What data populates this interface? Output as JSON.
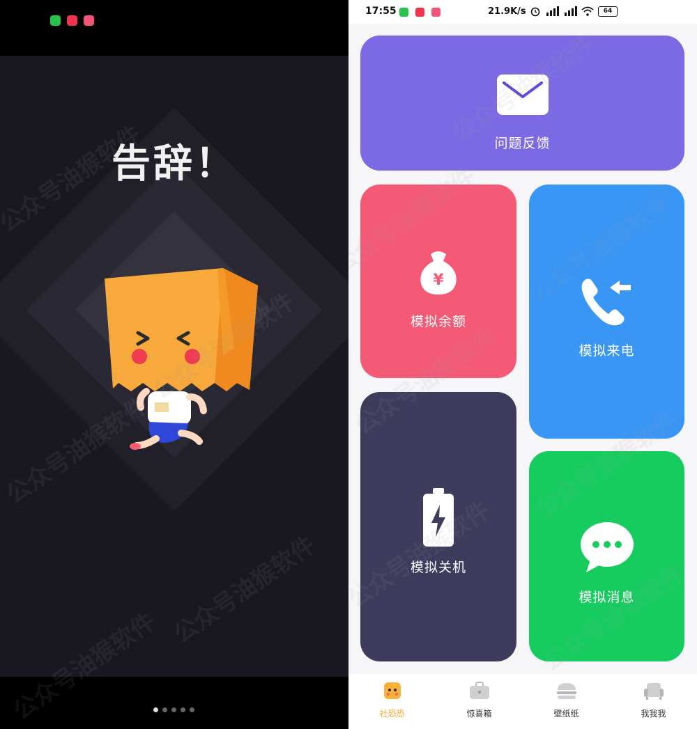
{
  "left_screen": {
    "headline": "告辞！",
    "pager": {
      "count": 5,
      "active_index": 0
    },
    "status_app_icons": [
      "wechat-icon",
      "app-red-icon",
      "app-pink-icon"
    ]
  },
  "right_screen": {
    "status_bar": {
      "time": "17:55",
      "net_speed": "21.9K/s",
      "battery": "64"
    },
    "cards": {
      "feedback": {
        "label": "问题反馈",
        "icon": "envelope-icon",
        "color": "#7b6ae4"
      },
      "balance": {
        "label": "模拟余额",
        "icon": "money-bag-icon",
        "color": "#f45a76"
      },
      "shutdown": {
        "label": "模拟关机",
        "icon": "battery-icon",
        "color": "#3d3c5c"
      },
      "call": {
        "label": "模拟来电",
        "icon": "incoming-call-icon",
        "color": "#3a96f5"
      },
      "message": {
        "label": "模拟消息",
        "icon": "chat-bubble-icon",
        "color": "#17cc5e"
      }
    },
    "tabbar": [
      {
        "label": "社恐恐",
        "icon": "mascot-icon",
        "active": true
      },
      {
        "label": "惊喜箱",
        "icon": "briefcase-icon",
        "active": false
      },
      {
        "label": "壁纸纸",
        "icon": "hamburger-icon",
        "active": false
      },
      {
        "label": "我我我",
        "icon": "sofa-icon",
        "active": false
      }
    ]
  },
  "watermark_text": "公众号油猴软件",
  "colors": {
    "left_bg": "#19171f",
    "accent_tab": "#f4a62a"
  }
}
